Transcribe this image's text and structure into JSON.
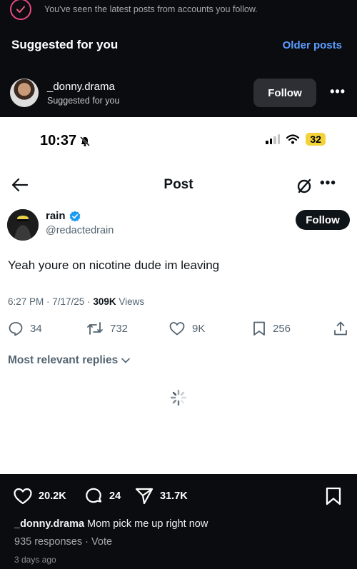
{
  "feed_notice": {
    "text": "You've seen the latest posts from accounts you follow."
  },
  "suggested": {
    "title": "Suggested for you",
    "older_posts": "Older posts"
  },
  "suggested_account": {
    "username": "_donny.drama",
    "subtitle": "Suggested for you",
    "follow_label": "Follow",
    "more_label": "•••"
  },
  "phone_status": {
    "time": "10:37",
    "battery": "32"
  },
  "x_post": {
    "header_title": "Post",
    "more_label": "•••",
    "author_name": "rain",
    "author_handle": "@redactedrain",
    "follow_label": "Follow",
    "text": "Yeah youre on nicotine dude im leaving",
    "timestamp": "6:27 PM · 7/17/25 · ",
    "views_count": "309K",
    "views_label": " Views",
    "replies": "34",
    "reposts": "732",
    "likes": "9K",
    "bookmarks": "256",
    "sort_label": "Most relevant replies"
  },
  "ig_post": {
    "likes": "20.2K",
    "comments": "24",
    "shares": "31.7K",
    "caption_user": "_donny.drama",
    "caption_text": " Mom pick me up right now",
    "responses": "935 responses · Vote",
    "time_ago": "3 days ago"
  },
  "colors": {
    "ig_background": "#0b0c10",
    "ig_link": "#5b9cff",
    "x_verified": "#1d9bf0",
    "battery": "#f3d23a",
    "ring": "#e84a7b"
  }
}
